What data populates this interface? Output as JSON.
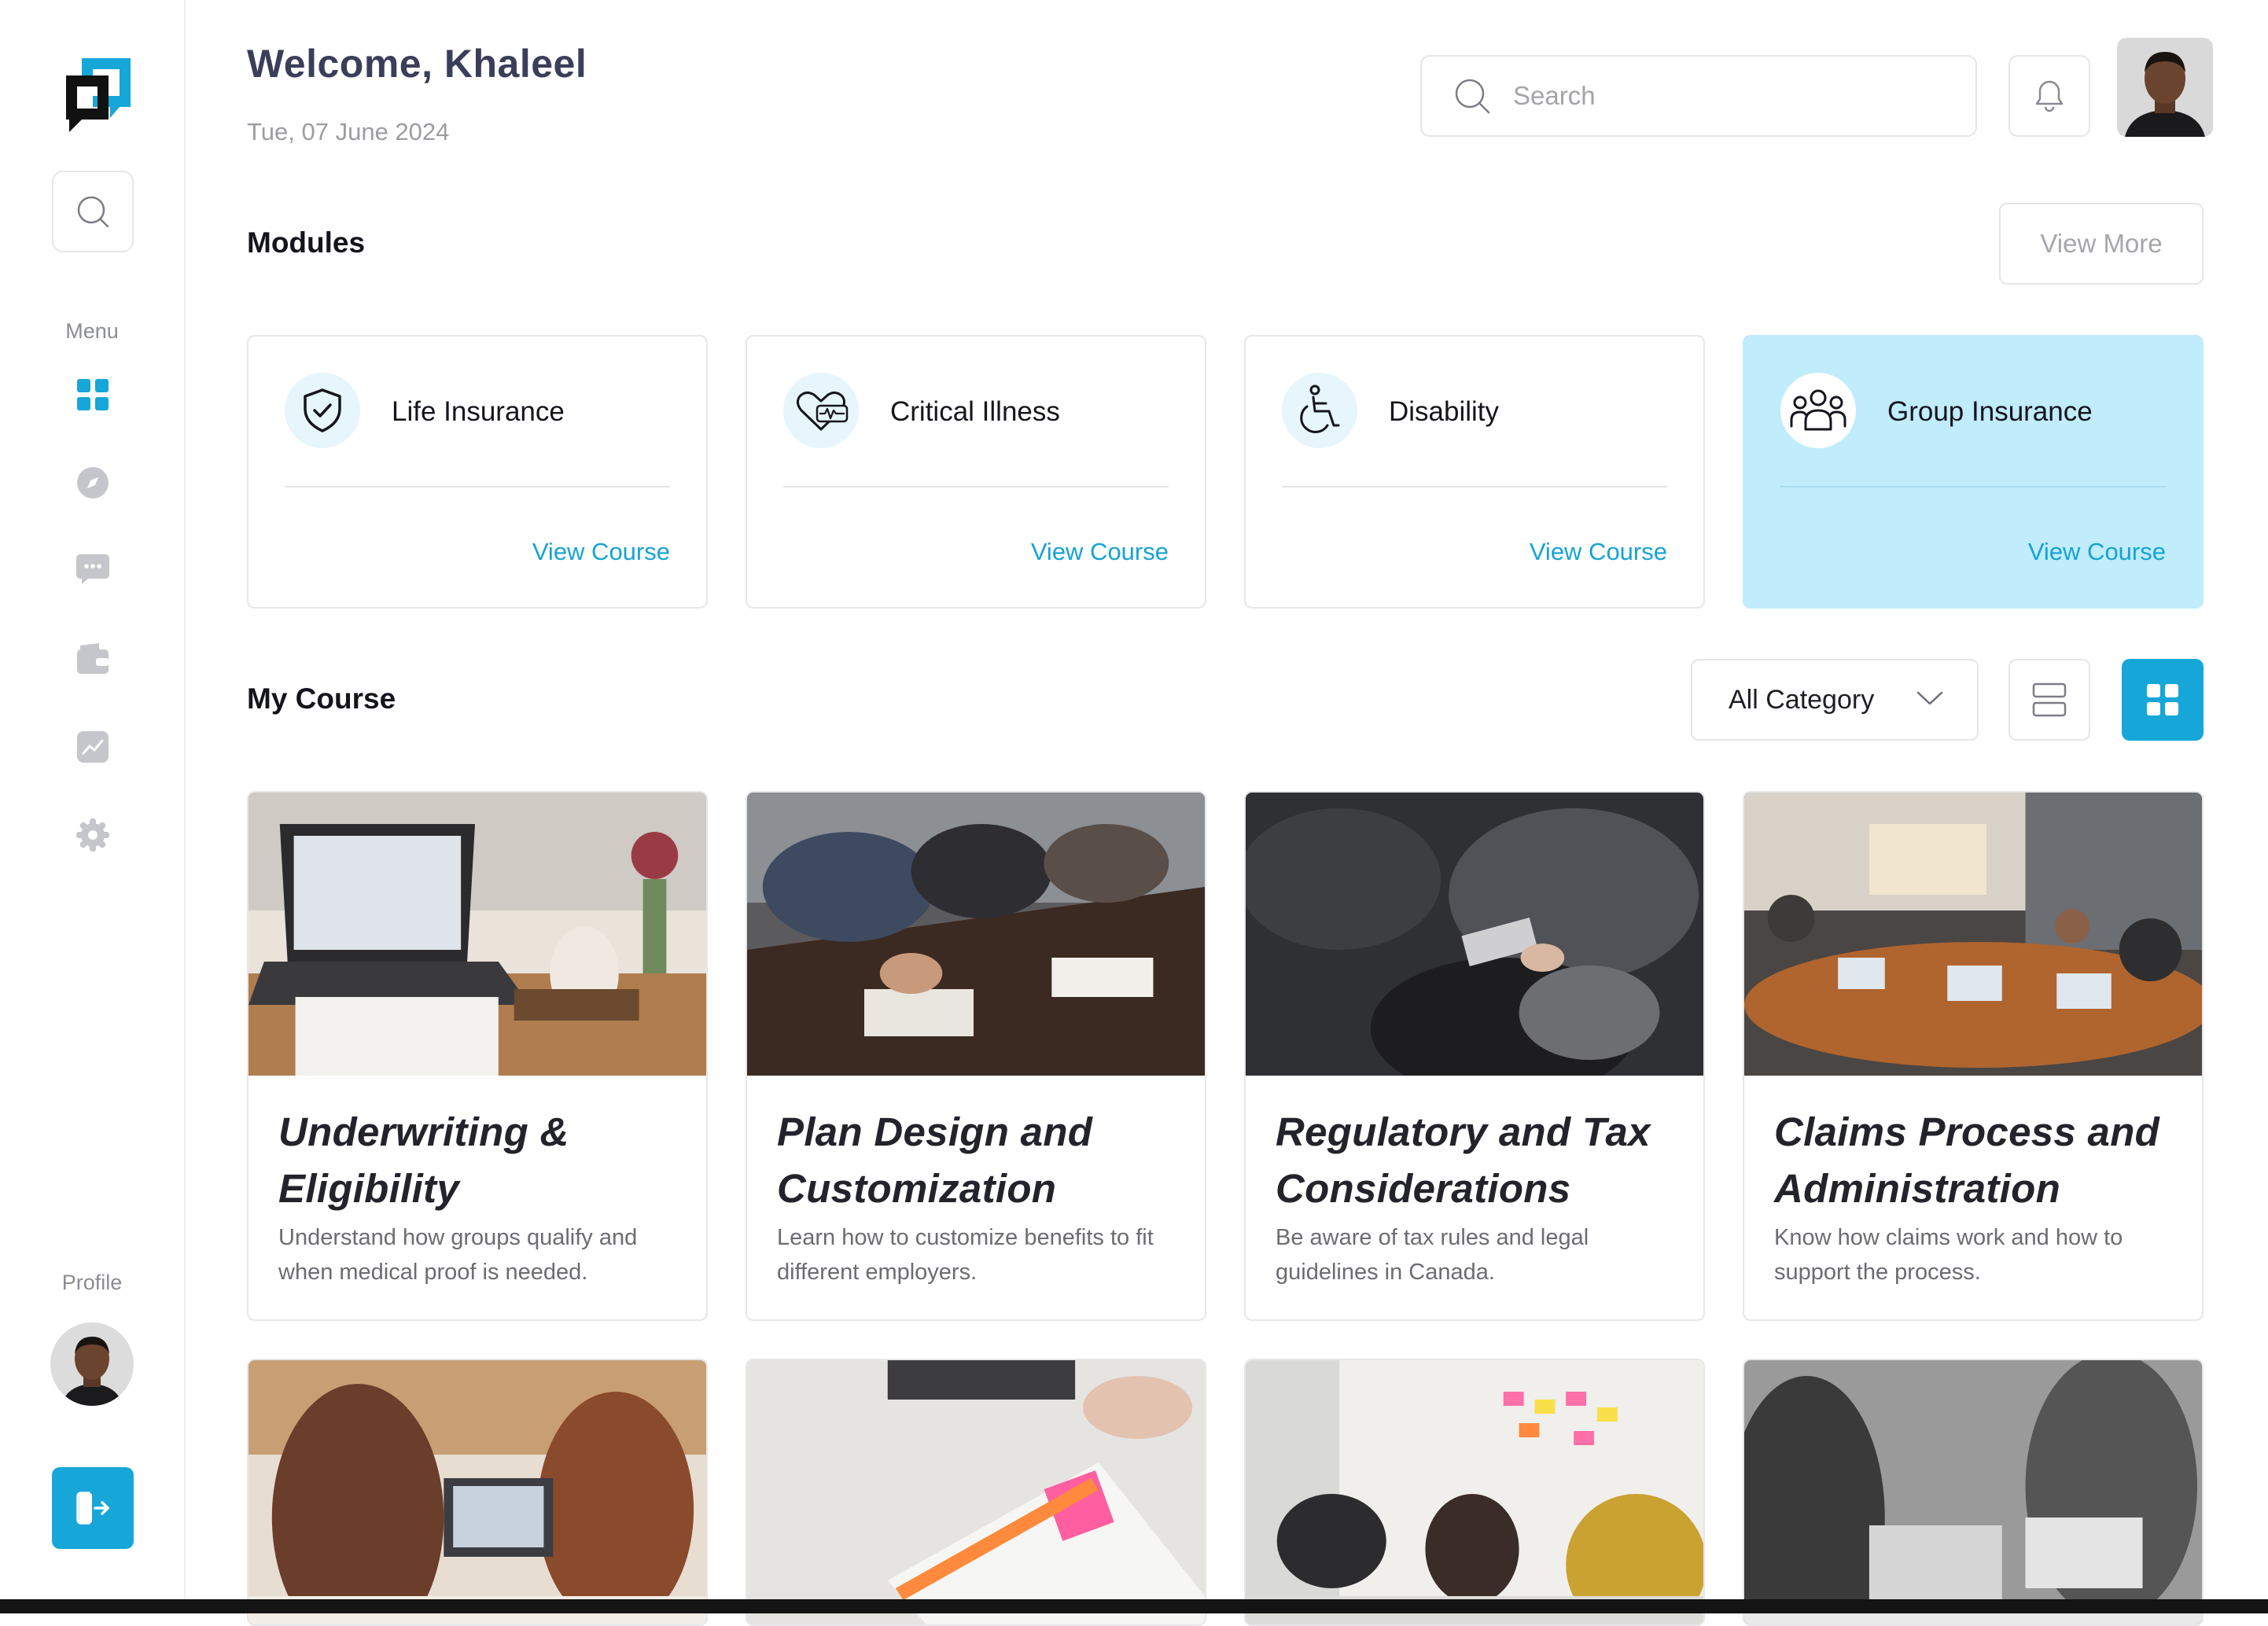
{
  "sidebar": {
    "menu_label": "Menu",
    "profile_label": "Profile",
    "nav": [
      {
        "icon": "dashboard-icon",
        "active": true
      },
      {
        "icon": "compass-icon",
        "active": false
      },
      {
        "icon": "chat-icon",
        "active": false
      },
      {
        "icon": "wallet-icon",
        "active": false
      },
      {
        "icon": "analytics-icon",
        "active": false
      },
      {
        "icon": "settings-icon",
        "active": false
      }
    ]
  },
  "header": {
    "welcome": "Welcome, Khaleel",
    "date": "Tue, 07 June 2024",
    "search_placeholder": "Search"
  },
  "modules": {
    "title": "Modules",
    "view_more": "View More",
    "items": [
      {
        "title": "Life Insurance",
        "link": "View Course",
        "icon": "shield-check-icon"
      },
      {
        "title": "Critical Illness",
        "link": "View Course",
        "icon": "heart-pulse-icon"
      },
      {
        "title": "Disability",
        "link": "View Course",
        "icon": "wheelchair-icon"
      },
      {
        "title": "Group Insurance",
        "link": "View Course",
        "icon": "group-icon",
        "active": true
      }
    ]
  },
  "courses": {
    "title": "My Course",
    "category": "All Category",
    "items": [
      {
        "title": "Underwriting & Eligibility",
        "desc": "Understand how groups qualify and when medical proof is needed."
      },
      {
        "title": "Plan Design and Customization",
        "desc": "Learn how to customize benefits to fit different employers."
      },
      {
        "title": "Regulatory and Tax Considerations",
        "desc": "Be aware of tax rules and legal guidelines in Canada."
      },
      {
        "title": "Claims Process and Administration",
        "desc": "Know how claims work and how to support the process."
      }
    ]
  },
  "colors": {
    "accent": "#16a7d8",
    "active_card": "#c0ecfb",
    "link": "#16a3d4"
  }
}
